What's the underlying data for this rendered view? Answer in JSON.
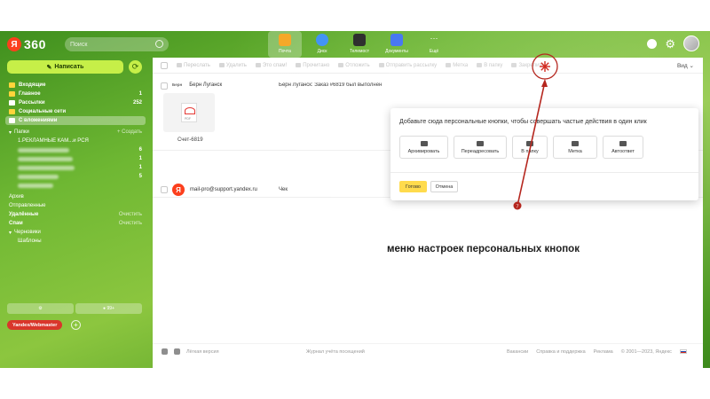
{
  "topbar": {
    "logo_text": "360",
    "logo_letter": "Я",
    "search_placeholder": "Поиск",
    "apps": [
      {
        "label": "Почта",
        "color": "#f5a623"
      },
      {
        "label": "Диск",
        "color": "#3b8ff5"
      },
      {
        "label": "Телемост",
        "color": "#222222"
      },
      {
        "label": "Документы",
        "color": "#3a6df0"
      },
      {
        "label": "Ещё",
        "color": "#ffffff"
      }
    ]
  },
  "sidebar": {
    "compose_label": "Написать",
    "folders": [
      {
        "label": "Входящие",
        "count": ""
      },
      {
        "label": "Главное",
        "count": "1"
      },
      {
        "label": "Рассылки",
        "count": "252"
      },
      {
        "label": "Социальные сети",
        "count": ""
      },
      {
        "label": "С вложениями",
        "count": ""
      }
    ],
    "groups_label": "Папки",
    "groups_action": "+ Создать",
    "sub_first": "1.РЕКЛАМНЫЕ КАМ...и РСЯ",
    "sub_counts": [
      "6",
      "1",
      "1",
      "5"
    ],
    "archive": "Архив",
    "sent": "Отправленные",
    "deleted": "Удалённые",
    "spam": "Спам",
    "clear_label": "Очистить",
    "drafts": "Черновики",
    "templates": "Шаблоны",
    "storage": "99+",
    "webmaster": "Yandex/Webmaster"
  },
  "toolbar": {
    "items": [
      "Переслать",
      "Удалить",
      "Это спам!",
      "Прочитано",
      "Отложить",
      "Отправить рассылку",
      "Метка",
      "В папку",
      "Закрепить"
    ],
    "view": "Вид"
  },
  "messages": [
    {
      "tag": "Берн",
      "from": "Берн Луганск",
      "subject": "Берн Луганск: Заказ #6819 был выполнен",
      "attachment": "Счет-6819",
      "attachment_ext": "PDF"
    },
    {
      "from": "mail-pro@support.yandex.ru",
      "subject": "Чек"
    }
  ],
  "popup": {
    "text": "Добавьте сюда персональные кнопки, чтобы совершать частые действия в один клик",
    "buttons": [
      "Архивировать",
      "Переадресовать",
      "В папку",
      "Метка",
      "Автоответ"
    ],
    "done": "Готово",
    "cancel": "Отмена"
  },
  "annotation": {
    "badge": "7",
    "text": "меню настроек персональных кнопок",
    "color": "#b5261e"
  },
  "footer": {
    "lite": "Лёгкая версия",
    "journal": "Журнал учёта посещений",
    "links": [
      "Вакансии",
      "Справка и поддержка",
      "Реклама"
    ],
    "copyright": "© 2001—2023, Яндекс"
  }
}
